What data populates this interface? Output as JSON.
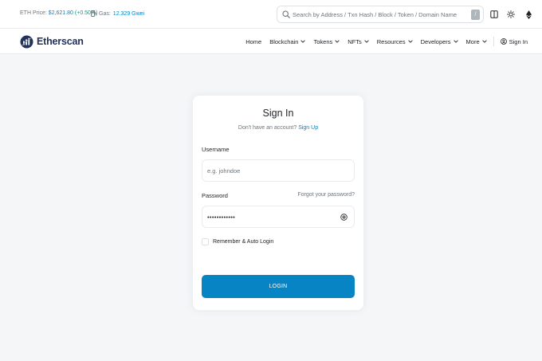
{
  "colors": {
    "accent": "#0784c3",
    "positive": "#00a186",
    "brand": "#21325b",
    "background": "#f5f6f8"
  },
  "topbar": {
    "eth_price_label": "ETH Price:",
    "eth_price_value": "$2,621.80",
    "eth_price_change": "(+0.50%)",
    "gas_label": "Gas:",
    "gas_value": "12.329 Gwei",
    "search_placeholder": "Search by Address / Txn Hash / Block / Token / Domain Name",
    "search_shortcut": "/",
    "icons": [
      "search-icon",
      "gas-pump-icon",
      "layout-icon",
      "sun-icon",
      "ethereum-icon"
    ]
  },
  "nav": {
    "brand": "Etherscan",
    "items": [
      {
        "label": "Home",
        "dropdown": false
      },
      {
        "label": "Blockchain",
        "dropdown": true
      },
      {
        "label": "Tokens",
        "dropdown": true
      },
      {
        "label": "NFTs",
        "dropdown": true
      },
      {
        "label": "Resources",
        "dropdown": true
      },
      {
        "label": "Developers",
        "dropdown": true
      },
      {
        "label": "More",
        "dropdown": true
      }
    ],
    "signin_label": "Sign In"
  },
  "signin": {
    "title": "Sign In",
    "no_account_text": "Don't have an account?",
    "signup_link": "Sign Up",
    "username_label": "Username",
    "username_placeholder": "e.g. johndoe",
    "password_label": "Password",
    "forgot_link": "Forgot your password?",
    "password_value": "••••••••••••",
    "remember_label": "Remember & Auto Login",
    "login_button": "LOGIN"
  }
}
